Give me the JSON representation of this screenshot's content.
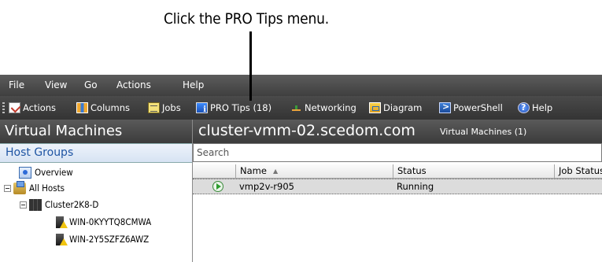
{
  "callout": {
    "text": "Click the PRO Tips menu."
  },
  "menubar": {
    "items": [
      "File",
      "View",
      "Go",
      "Actions",
      "Help"
    ]
  },
  "toolbar": {
    "buttons": [
      {
        "label": "Actions",
        "icon": "actions-icon"
      },
      {
        "label": "Columns",
        "icon": "columns-icon"
      },
      {
        "label": "Jobs",
        "icon": "jobs-icon"
      },
      {
        "label": "PRO Tips (18)",
        "icon": "pro-tips-icon"
      },
      {
        "label": "Networking",
        "icon": "networking-icon"
      },
      {
        "label": "Diagram",
        "icon": "diagram-icon"
      },
      {
        "label": "PowerShell",
        "icon": "powershell-icon"
      },
      {
        "label": "Help",
        "icon": "help-icon"
      }
    ]
  },
  "left_panel": {
    "title": "Virtual Machines",
    "section": "Host Groups",
    "tree": [
      {
        "label": "Overview",
        "icon": "overview-icon"
      },
      {
        "label": "All Hosts",
        "icon": "host-group-icon"
      },
      {
        "label": "Cluster2K8-D",
        "icon": "cluster-icon"
      },
      {
        "label": "WIN-0KYYTQ8CMWA",
        "icon": "host-warning-icon"
      },
      {
        "label": "WIN-2Y5SZFZ6AWZ",
        "icon": "host-warning-icon"
      }
    ]
  },
  "main": {
    "title": "cluster-vmm-02.scedom.com",
    "subtitle": "Virtual Machines (1)",
    "search_placeholder": "Search",
    "columns": [
      "Name",
      "Status",
      "Job Status"
    ],
    "rows": [
      {
        "name": "vmp2v-r905",
        "status": "Running",
        "job_status": "",
        "icon": "running-icon"
      }
    ]
  },
  "colors": {
    "dark_bar": "#3f3f3f",
    "host_groups_text": "#1f55a3",
    "selected_row": "#dcdcdc"
  }
}
